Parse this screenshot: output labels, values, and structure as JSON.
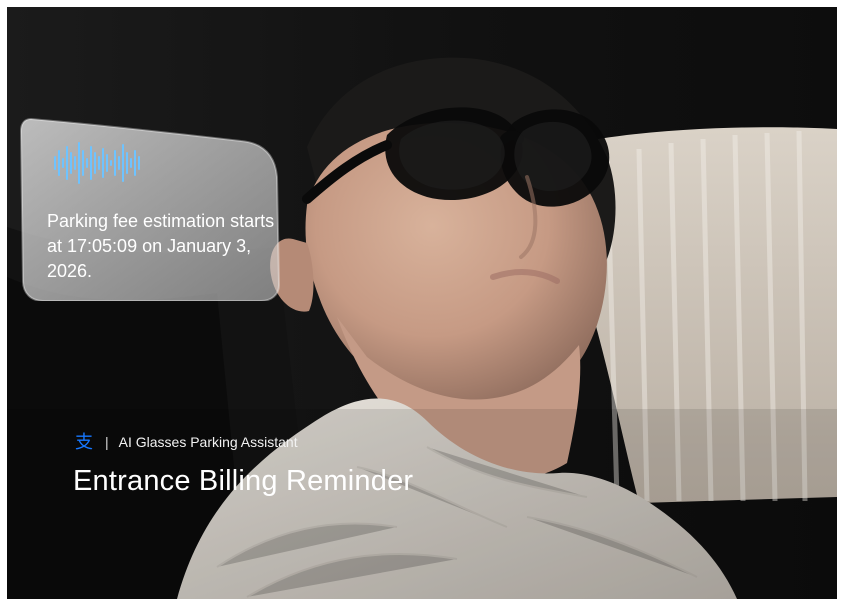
{
  "notification": {
    "message_line1": "Parking fee estimation starts",
    "message_line2": "at 17:05:09 on January 3, 2026."
  },
  "caption": {
    "brand_logo_char": "支",
    "brand_divider": "|",
    "subtitle": "AI Glasses Parking Assistant",
    "title": "Entrance Billing Reminder"
  },
  "colors": {
    "wave_blue": "#6EC3FF",
    "logo_blue": "#1677FF",
    "bubble_fill": "#D9D9D9"
  },
  "icons": {
    "voice_wave": "voice-waveform-icon"
  }
}
